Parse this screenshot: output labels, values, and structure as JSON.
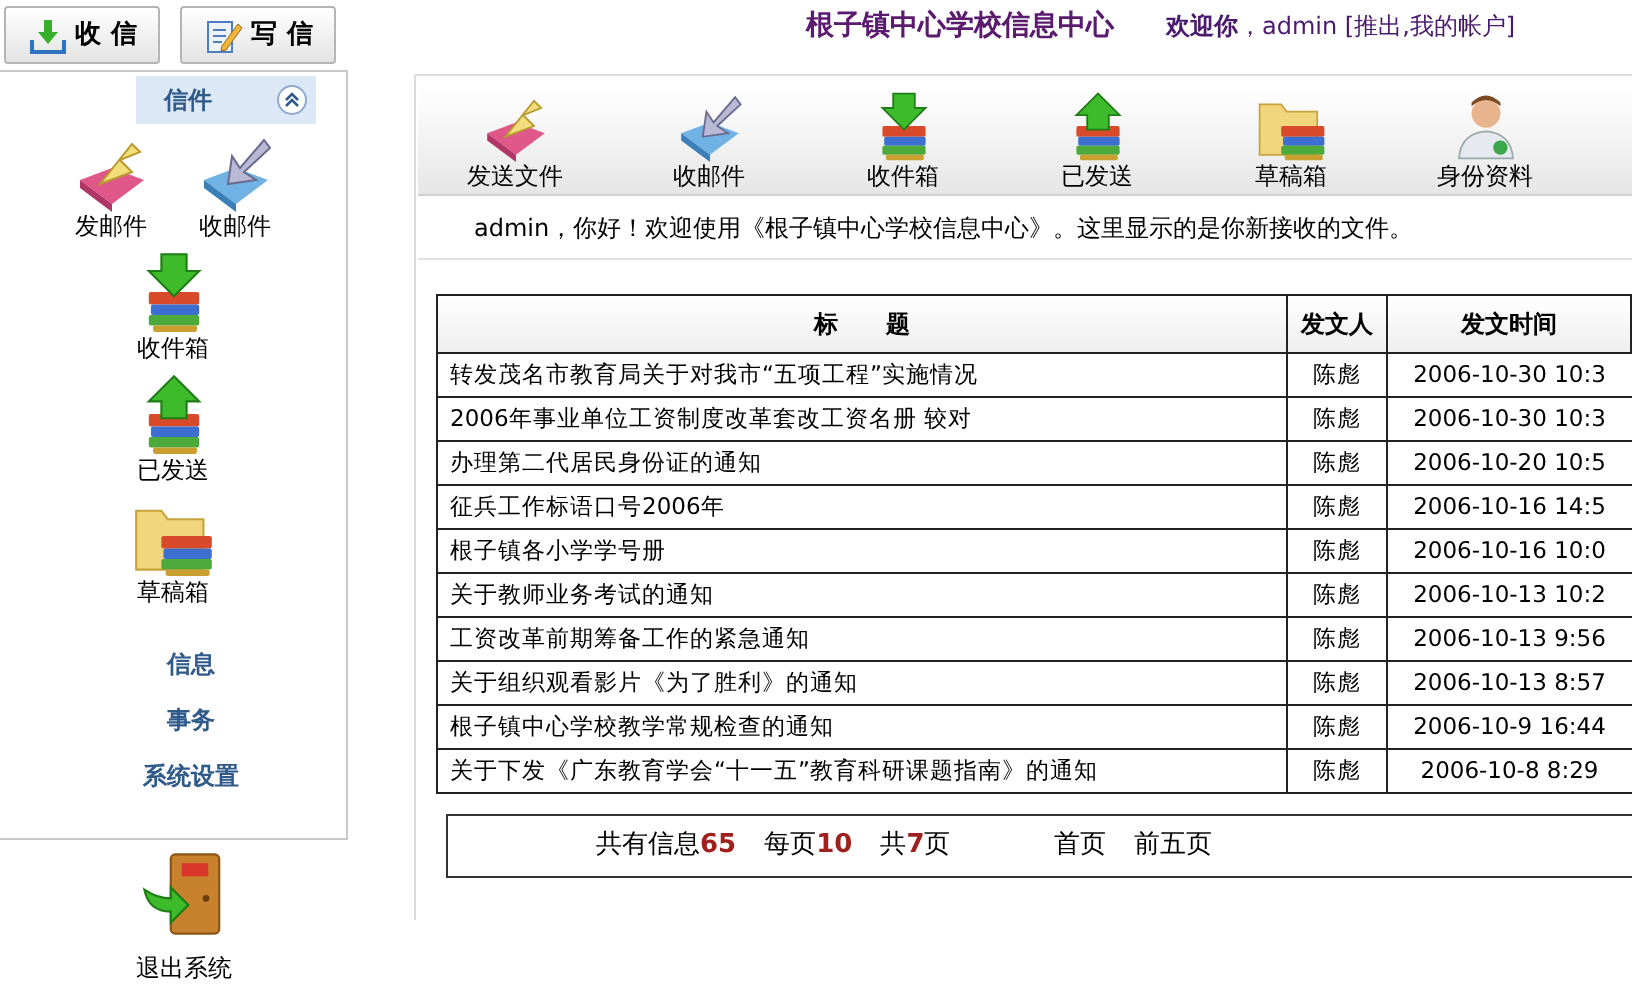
{
  "top_buttons": [
    {
      "label": "收 信",
      "kind": "receive"
    },
    {
      "label": "写 信",
      "kind": "write"
    }
  ],
  "header": {
    "title": "根子镇中心学校信息中心",
    "greeting": "欢迎你",
    "account": "，admin [推出,我的帐户]"
  },
  "sidebar": {
    "section": {
      "title": "信件",
      "expanded": true
    },
    "icons": [
      {
        "label": "发邮件",
        "kind": "send"
      },
      {
        "label": "收邮件",
        "kind": "receive"
      },
      {
        "label": "收件箱",
        "kind": "inbox"
      },
      {
        "label": "已发送",
        "kind": "sent"
      },
      {
        "label": "草稿箱",
        "kind": "drafts"
      }
    ],
    "links": [
      "信息",
      "事务",
      "系统设置"
    ],
    "exit": {
      "label": "退出系统",
      "kind": "exit"
    }
  },
  "toolbar": [
    {
      "label": "发送文件",
      "kind": "send"
    },
    {
      "label": "收邮件",
      "kind": "receive"
    },
    {
      "label": "收件箱",
      "kind": "inbox"
    },
    {
      "label": "已发送",
      "kind": "sent"
    },
    {
      "label": "草稿箱",
      "kind": "drafts"
    },
    {
      "label": "身份资料",
      "kind": "profile"
    }
  ],
  "welcome": "admin，你好！欢迎使用《根子镇中心学校信息中心》。这里显示的是你新接收的文件。",
  "table": {
    "columns": [
      "标　　题",
      "发文人",
      "发文时间"
    ],
    "rows": [
      [
        "转发茂名市教育局关于对我市“五项工程”实施情况",
        "陈彪",
        "2006-10-30 10:3"
      ],
      [
        "2006年事业单位工资制度改革套改工资名册 较对",
        "陈彪",
        "2006-10-30 10:3"
      ],
      [
        "办理第二代居民身份证的通知",
        "陈彪",
        "2006-10-20 10:5"
      ],
      [
        "征兵工作标语口号2006年",
        "陈彪",
        "2006-10-16 14:5"
      ],
      [
        "根子镇各小学学号册",
        "陈彪",
        "2006-10-16 10:0"
      ],
      [
        "关于教师业务考试的通知",
        "陈彪",
        "2006-10-13 10:2"
      ],
      [
        "工资改革前期筹备工作的紧急通知",
        "陈彪",
        "2006-10-13 9:56"
      ],
      [
        "关于组织观看影片《为了胜利》的通知",
        "陈彪",
        "2006-10-13 8:57"
      ],
      [
        "根子镇中心学校教学常规检查的通知",
        "陈彪",
        "2006-10-9 16:44"
      ],
      [
        "关于下发《广东教育学会“十一五”教育科研课题指南》的通知",
        "陈彪",
        "2006-10-8 8:29"
      ]
    ]
  },
  "pagination": {
    "total_label": "共有信息",
    "total": "65",
    "per_page_label": "每页",
    "per_page": "10",
    "pages_prefix": "共",
    "pages": "7",
    "pages_suffix": "页",
    "links": [
      "首页",
      "前五页"
    ]
  }
}
